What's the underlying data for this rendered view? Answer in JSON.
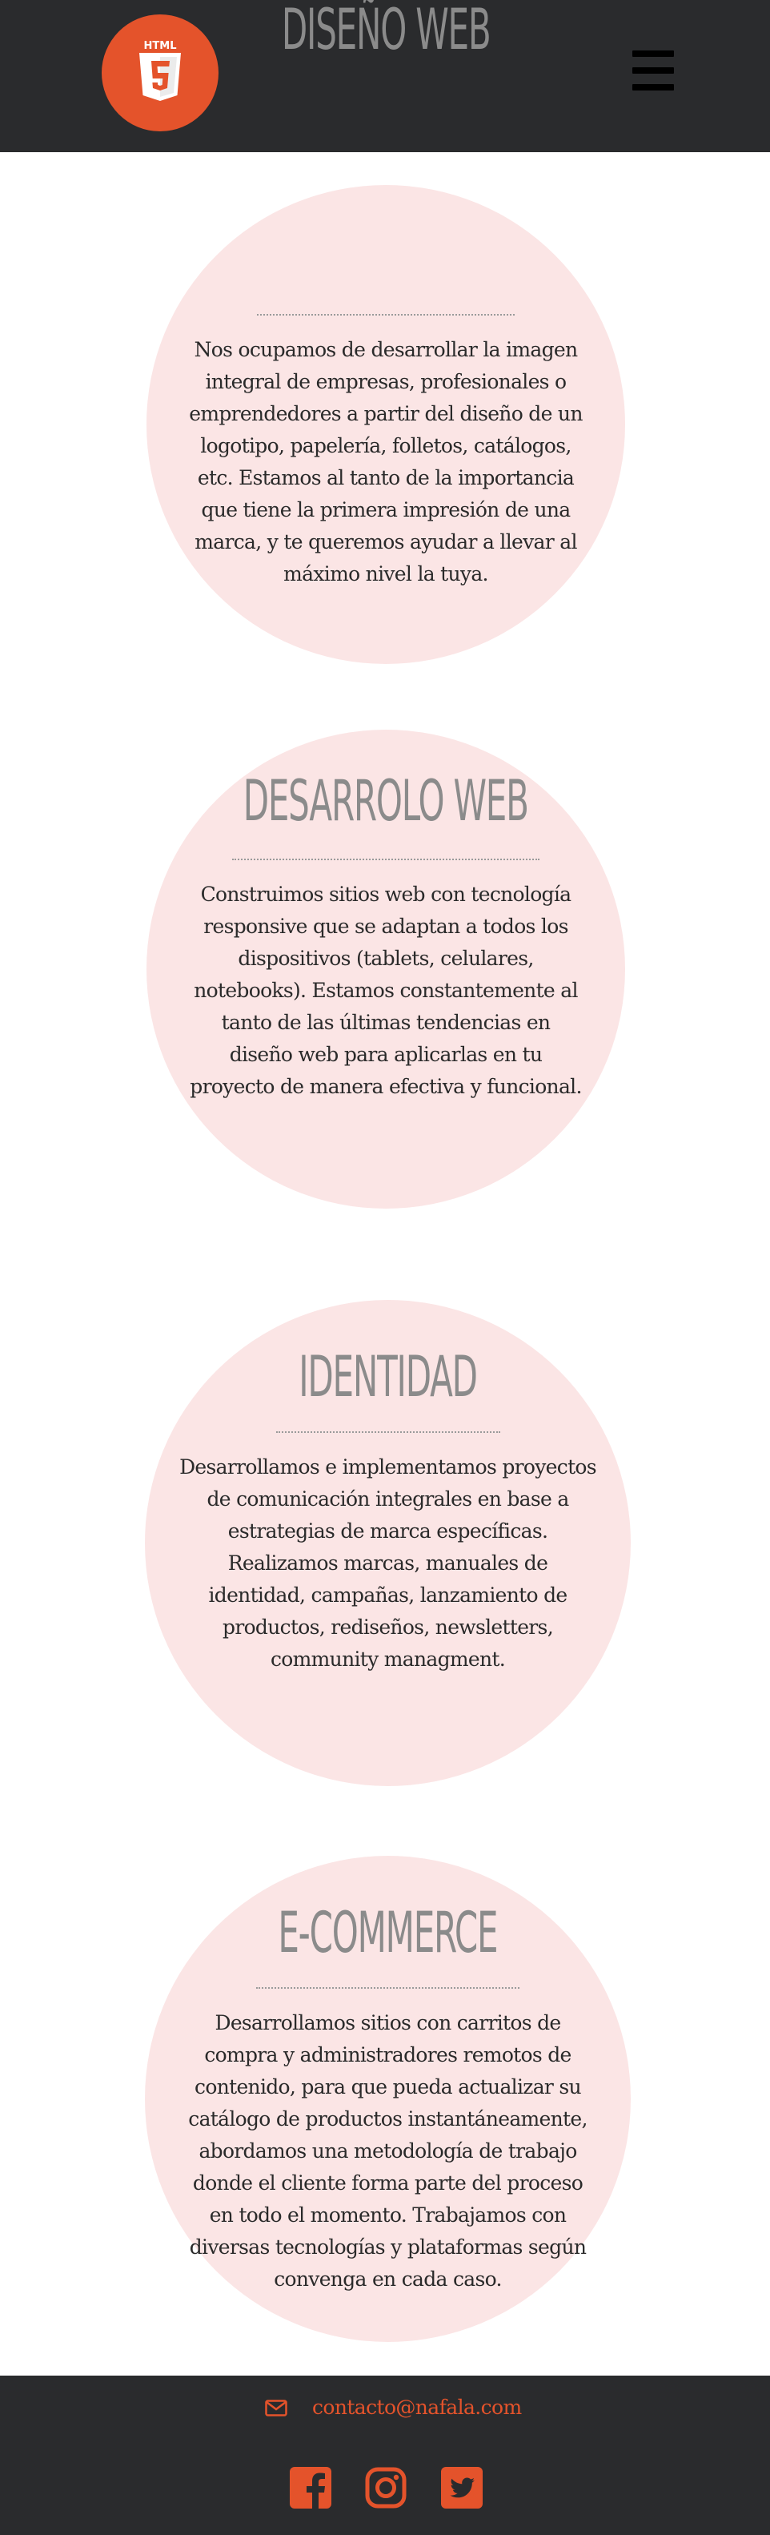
{
  "header": {
    "logo_text": "HTML",
    "logo_digit": "5",
    "logo_icon": "html5-logo-icon",
    "menu_icon": "hamburger-menu-icon"
  },
  "services": [
    {
      "title": "DISEÑO WEB",
      "text": "Nos ocupamos de desarrollar la imagen integral de empresas, profesionales o emprendedores a partir del diseño de un logotipo, papelería, folletos, catálogos, etc. Estamos al tanto de la importancia que tiene la primera impresión de una marca, y te queremos ayudar a llevar al máximo nivel la tuya."
    },
    {
      "title": "DESARROLO WEB",
      "text": "Construimos sitios web con tecnología responsive que se adaptan a todos los dispositivos (tablets, celulares, notebooks). Estamos constantemente al tanto de las últimas tendencias en diseño web para aplicarlas en tu proyecto de manera efectiva y funcional."
    },
    {
      "title": "IDENTIDAD",
      "text": "Desarrollamos e implementamos proyectos de comunicación integrales en base a estrategias de marca específicas. Realizamos marcas, manuales de identidad, campañas, lanzamiento de productos, rediseños, newsletters, community managment."
    },
    {
      "title": "E-COMMERCE",
      "text": "Desarrollamos sitios con carritos de compra y administradores remotos de contenido, para que pueda actualizar su catálogo de productos instantáneamente, abordamos una metodología de trabajo donde el cliente forma parte del proceso en todo el momento. Trabajamos con diversas tecnologías y plataformas según convenga en cada caso."
    }
  ],
  "footer": {
    "email": "contacto@nafala.com",
    "email_icon": "envelope-icon",
    "social_icons": [
      "facebook-icon",
      "instagram-icon",
      "twitter-icon"
    ]
  },
  "colors": {
    "accent": "#e4532b",
    "header_bg": "#2a2b2d",
    "circle_bg": "#fbe5e5",
    "title_gray": "#8b8b8b"
  }
}
